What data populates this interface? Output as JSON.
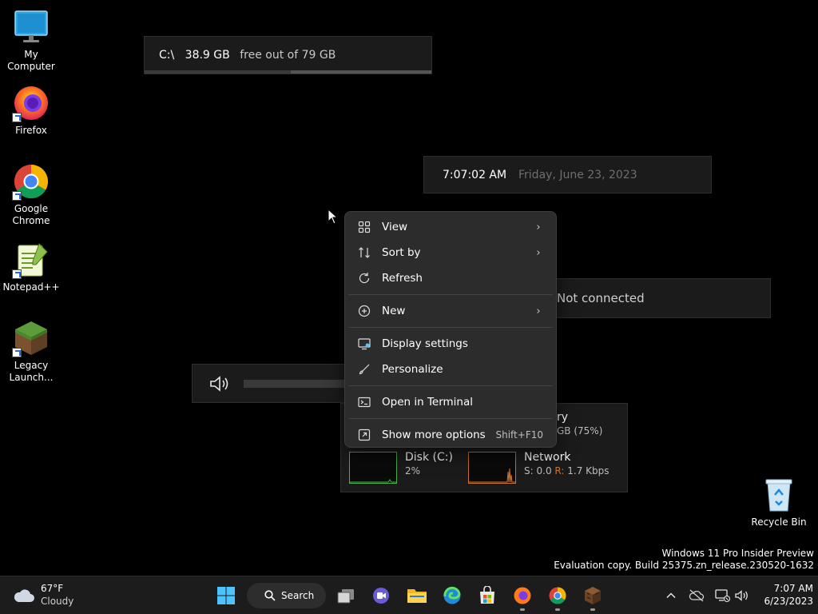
{
  "desktop": {
    "icons": [
      {
        "label": "My Computer"
      },
      {
        "label": "Firefox"
      },
      {
        "label": "Google Chrome"
      },
      {
        "label": "Notepad++"
      },
      {
        "label": "Legacy Launch..."
      },
      {
        "label": "Recycle Bin"
      }
    ],
    "watermark": {
      "line1": "Windows 11 Pro Insider Preview",
      "line2": "Evaluation copy. Build 25375.zn_release.230520-1632"
    }
  },
  "widgets": {
    "disk": {
      "drive": "C:\\",
      "free": "38.9 GB",
      "suffix": "free out of 79 GB",
      "used_fraction": 0.51
    },
    "clock": {
      "time": "7:07:02 AM",
      "date": "Friday, June 23, 2023"
    },
    "network_status": "Not connected",
    "perf": {
      "memory_label_partial": "ry",
      "memory_value_partial": "GB (75%)",
      "disk_label": "Disk (C:)",
      "disk_value": "2%",
      "network_label": "Network",
      "network_send_label": "S:",
      "network_send": "0.0",
      "network_recv_label": "R:",
      "network_recv": "1.7 Kbps"
    }
  },
  "context_menu": {
    "items": [
      {
        "label": "View",
        "icon": "grid-icon",
        "submenu": true
      },
      {
        "label": "Sort by",
        "icon": "sort-icon",
        "submenu": true
      },
      {
        "label": "Refresh",
        "icon": "refresh-icon",
        "submenu": false
      },
      {
        "label": "New",
        "icon": "plus-circle-icon",
        "submenu": true
      },
      {
        "label": "Display settings",
        "icon": "monitor-icon",
        "submenu": false
      },
      {
        "label": "Personalize",
        "icon": "brush-icon",
        "submenu": false
      },
      {
        "label": "Open in Terminal",
        "icon": "terminal-icon",
        "submenu": false
      },
      {
        "label": "Show more options",
        "icon": "expand-icon",
        "submenu": false,
        "shortcut": "Shift+F10"
      }
    ]
  },
  "taskbar": {
    "weather": {
      "temp": "67°F",
      "condition": "Cloudy"
    },
    "search_label": "Search",
    "clock": {
      "time": "7:07 AM",
      "date": "6/23/2023"
    }
  },
  "colors": {
    "accent": "#4cc2ff",
    "perf_disk": "#4caf50",
    "perf_network": "#c87533"
  }
}
